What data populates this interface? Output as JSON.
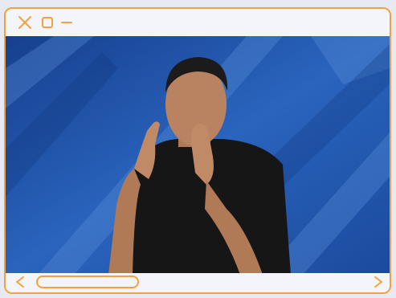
{
  "window": {
    "accent_color": "#f1a13f",
    "background_color": "#f3f5fb",
    "controls": [
      {
        "icon": "close-icon"
      },
      {
        "icon": "maximize-icon"
      },
      {
        "icon": "minimize-icon"
      }
    ]
  },
  "video": {
    "content": "sign-language-interpreter-video-frame",
    "background_color": "#1e4fa7"
  },
  "navigation": {
    "previous_icon": "chevron-left-icon",
    "next_icon": "chevron-right-icon",
    "scrollbar": "horizontal-scrollbar"
  }
}
